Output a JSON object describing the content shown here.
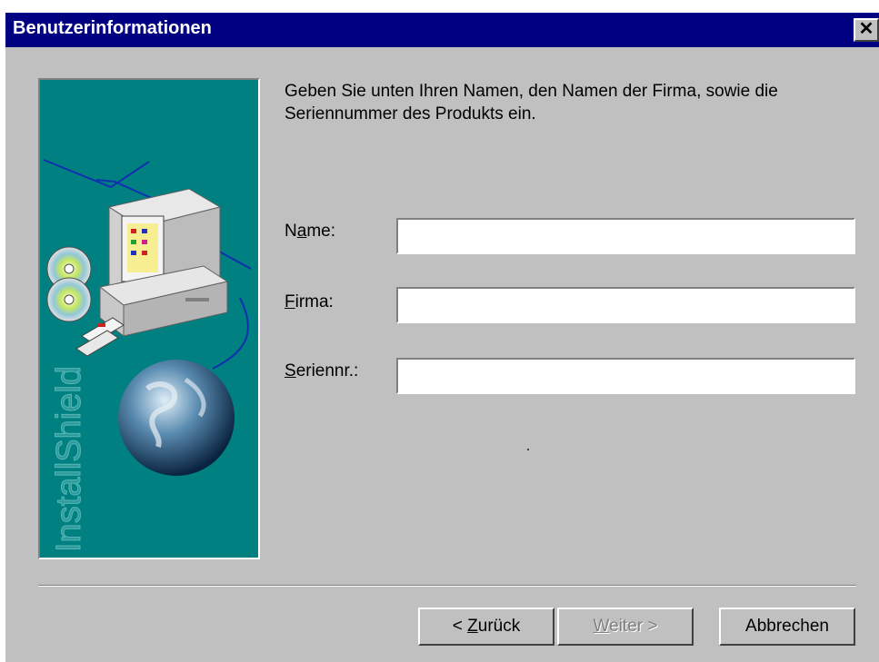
{
  "window": {
    "title": "Benutzerinformationen",
    "close_glyph": "✕"
  },
  "image_panel": {
    "brand": "InstallShield"
  },
  "intro_text": "Geben Sie unten Ihren Namen, den Namen der Firma, sowie die Seriennummer des Produkts ein.",
  "fields": {
    "name": {
      "label_pre": "N",
      "label_accel": "a",
      "label_post": "me:",
      "value": ""
    },
    "firma": {
      "label_pre": "",
      "label_accel": "F",
      "label_post": "irma:",
      "value": ""
    },
    "seriennr": {
      "label_pre": "",
      "label_accel": "S",
      "label_post": "eriennr.:",
      "value": ""
    }
  },
  "buttons": {
    "back": {
      "pre": "< ",
      "accel": "Z",
      "post": "urück"
    },
    "next": {
      "pre": "",
      "accel": "W",
      "post": "eiter >"
    },
    "cancel": {
      "label": "Abbrechen"
    }
  },
  "colors": {
    "titlebar": "#000080",
    "dialog": "#c0c0c0",
    "panel": "#008080"
  }
}
